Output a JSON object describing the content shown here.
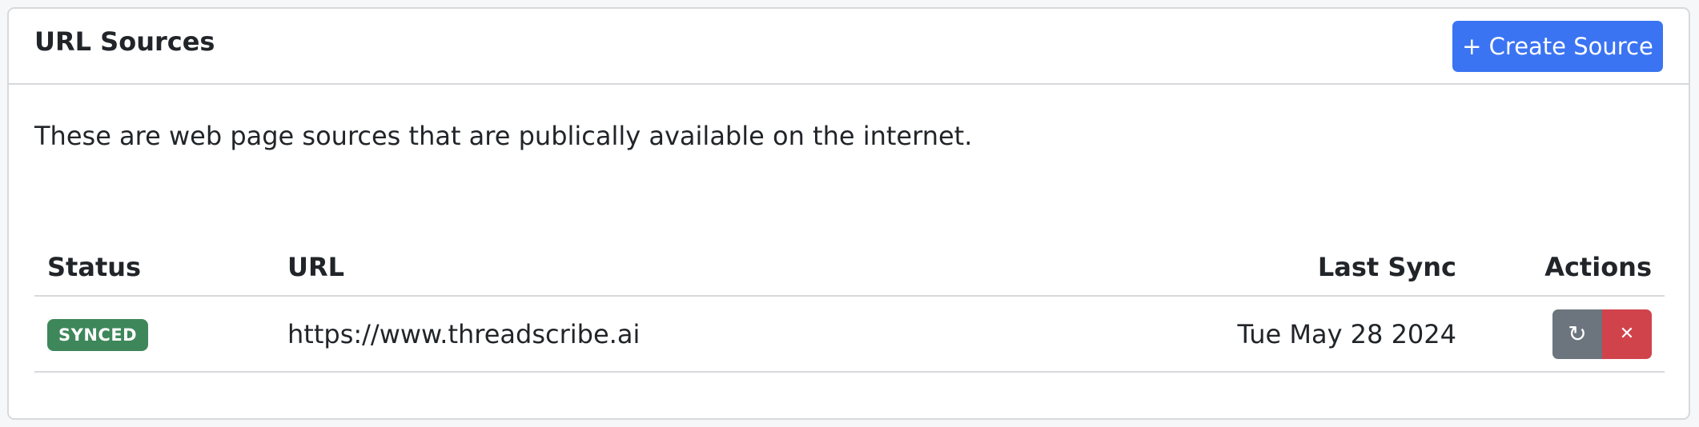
{
  "header": {
    "title": "URL Sources",
    "create_label": "+ Create Source"
  },
  "description": "These are web page sources that are publically available on the internet.",
  "table": {
    "columns": [
      "Status",
      "URL",
      "Last Sync",
      "Actions"
    ],
    "rows": [
      {
        "status": "SYNCED",
        "url": "https://www.threadscribe.ai",
        "last_sync": "Tue May 28 2024",
        "actions": {
          "sync_icon": "refresh-icon",
          "delete_icon": "close-icon"
        }
      }
    ]
  },
  "colors": {
    "primary": "#3b74f2",
    "success": "#3e875a",
    "secondary": "#6c757d",
    "danger": "#d1434b"
  }
}
